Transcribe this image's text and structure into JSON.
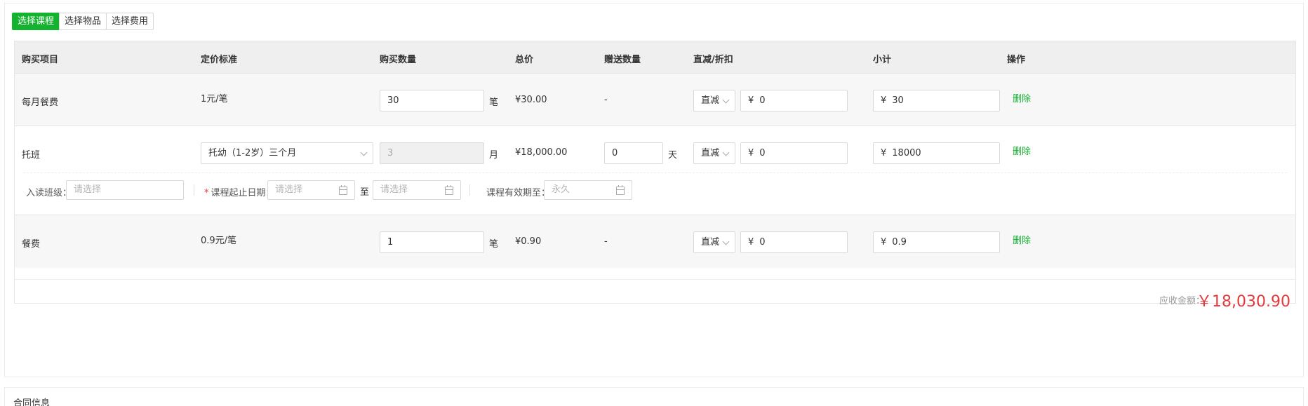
{
  "tabs": {
    "select_course": "选择课程",
    "select_item": "选择物品",
    "select_fee": "选择费用"
  },
  "table": {
    "headers": [
      "购买项目",
      "定价标准",
      "购买数量",
      "总价",
      "赠送数量",
      "直减/折扣",
      "小计",
      "操作"
    ],
    "rows": [
      {
        "item": "每月餐费",
        "price_standard": "1元/笔",
        "quantity": "30",
        "quantity_unit": "笔",
        "total": "¥30.00",
        "gift": "-",
        "discount_type": "直减",
        "discount_yen": "¥",
        "discount_value": "0",
        "subtotal_yen": "¥",
        "subtotal": "30",
        "action": "删除"
      },
      {
        "item": "托班",
        "price_select": "托幼（1-2岁）三个月",
        "quantity": "3",
        "quantity_unit": "月",
        "total": "¥18,000.00",
        "gift": "0",
        "gift_unit": "天",
        "discount_type": "直减",
        "discount_yen": "¥",
        "discount_value": "0",
        "subtotal_yen": "¥",
        "subtotal": "18000",
        "action": "删除",
        "extra": {
          "class_label": "入读班级：",
          "class_placeholder": "请选择",
          "required_mark": "*",
          "date_label": "课程起止日期：",
          "start_placeholder": "请选择",
          "to_label": "至",
          "end_placeholder": "请选择",
          "valid_label": "课程有效期至：",
          "valid_placeholder": "永久"
        }
      },
      {
        "item": "餐费",
        "price_standard": "0.9元/笔",
        "quantity": "1",
        "quantity_unit": "笔",
        "total": "¥0.90",
        "gift": "-",
        "discount_type": "直减",
        "discount_yen": "¥",
        "discount_value": "0",
        "subtotal_yen": "¥",
        "subtotal": "0.9",
        "action": "删除"
      }
    ]
  },
  "summary": {
    "label": "应收金额：",
    "amount": "￥18,030.90"
  },
  "contract": {
    "title": "合同信息"
  },
  "colors": {
    "accent_green": "#13b32f",
    "total_red": "#e4393c",
    "header_bg": "#efefef",
    "row_gray": "#f7f7f7"
  }
}
